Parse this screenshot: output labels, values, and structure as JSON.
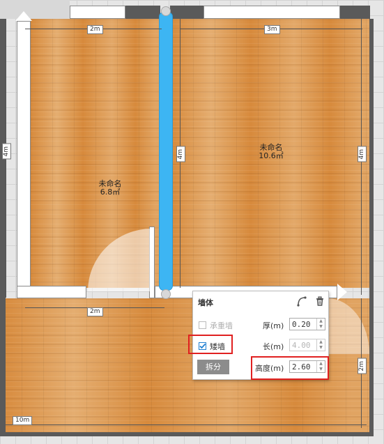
{
  "rooms": [
    {
      "name": "未命名",
      "area": "6.8㎡"
    },
    {
      "name": "未命名",
      "area": "10.6㎡"
    }
  ],
  "dimensions": {
    "top_left": "2m",
    "top_right": "3m",
    "left": "4m",
    "mid_left": "4m",
    "right": "4m",
    "middle_bottom": "2m",
    "right_lower": "2m",
    "bottom": "10m"
  },
  "panel": {
    "title": "墙体",
    "bearing_wall_label": "承重墙",
    "short_wall_label": "矮墙",
    "thickness_label": "厚(m)",
    "thickness_value": "0.20",
    "length_label": "长(m)",
    "length_value": "4.00",
    "height_label": "高度(m)",
    "height_value": "2.60",
    "split_label": "拆分",
    "bearing_wall_checked": false,
    "short_wall_checked": true
  },
  "icons": {
    "edit": "curve-wall-icon",
    "delete": "trash-icon"
  },
  "colors": {
    "selection": "#3db5f3",
    "highlight": "#e02020",
    "floor": "#d78a3c"
  }
}
